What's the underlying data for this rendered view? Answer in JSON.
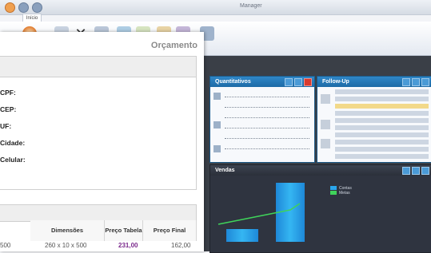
{
  "app": {
    "title": "Manager",
    "ribbon_tab": "Início",
    "colors": {
      "panel_header": "#1d6aa6",
      "bar": "#35b6f2",
      "line": "#3fd35a"
    }
  },
  "dashboard": {
    "quant_title": "Quantitativos",
    "follow_title": "Follow-Up",
    "chart_title": "Vendas",
    "chart_data": {
      "type": "bar",
      "series": [
        {
          "name": "Contas",
          "color": "#2aa6ec"
        },
        {
          "name": "Metas",
          "color": "#3fd35a"
        }
      ]
    }
  },
  "form": {
    "title": "Orçamento",
    "labels": {
      "cpf": "CPF:",
      "cep": "CEP:",
      "uf": "UF:",
      "cidade": "Cidade:",
      "celular": "Celular:"
    },
    "table": {
      "headers": {
        "dimensoes": "Dimensões",
        "preco_tabela": "Preço Tabela",
        "preco_final": "Preço Final"
      },
      "row": {
        "qty": "500",
        "dimensoes": "260 x 10 x 500",
        "preco_tabela": "231,00",
        "preco_final": "162,00"
      }
    }
  }
}
